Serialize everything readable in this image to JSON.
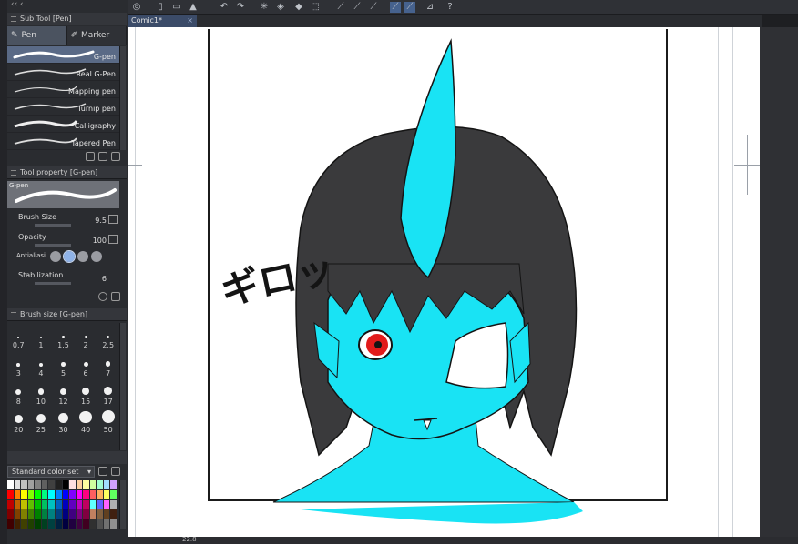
{
  "app": {
    "doc_tab": "Comic1*"
  },
  "subtool": {
    "header": "Sub Tool [Pen]",
    "tabs": [
      {
        "label": "Pen"
      },
      {
        "label": "Marker"
      }
    ],
    "brushes": [
      {
        "label": "G-pen"
      },
      {
        "label": "Real G-Pen"
      },
      {
        "label": "Mapping pen"
      },
      {
        "label": "Turnip pen"
      },
      {
        "label": "Calligraphy"
      },
      {
        "label": "Tapered Pen"
      }
    ]
  },
  "tool_property": {
    "header": "Tool property [G-pen]",
    "preview_label": "G-pen",
    "brush_size_label": "Brush Size",
    "brush_size_value": "9.5",
    "opacity_label": "Opacity",
    "opacity_value": "100",
    "antialias_label": "Antialiasi",
    "stabilization_label": "Stabilization",
    "stabilization_value": "6"
  },
  "brush_size_panel": {
    "header": "Brush size [G-pen]",
    "sizes": [
      "0.7",
      "1",
      "1.5",
      "2",
      "2.5",
      "3",
      "4",
      "5",
      "6",
      "7",
      "8",
      "10",
      "12",
      "15",
      "17",
      "20",
      "25",
      "30",
      "40",
      "50"
    ]
  },
  "color_set": {
    "label": "Standard color set",
    "colors": [
      "#ffffff",
      "#e0e0e0",
      "#c0c0c0",
      "#a0a0a0",
      "#808080",
      "#606060",
      "#404040",
      "#202020",
      "#000000",
      "#ffe0e0",
      "#ffd0a0",
      "#ffffa0",
      "#d0ffa0",
      "#a0ffd0",
      "#a0e0ff",
      "#d0a0ff",
      "#ff0000",
      "#ff8000",
      "#ffff00",
      "#80ff00",
      "#00ff00",
      "#00ff80",
      "#00ffff",
      "#0080ff",
      "#0000ff",
      "#8000ff",
      "#ff00ff",
      "#ff0080",
      "#ff6060",
      "#ffb060",
      "#ffff60",
      "#60ff60",
      "#c00000",
      "#c06000",
      "#c0c000",
      "#60c000",
      "#00c000",
      "#00c060",
      "#00c0c0",
      "#0060c0",
      "#0000c0",
      "#6000c0",
      "#c000c0",
      "#c00060",
      "#60ffff",
      "#6060ff",
      "#ff60ff",
      "#b0b0b0",
      "#800000",
      "#804000",
      "#808000",
      "#408000",
      "#008000",
      "#008040",
      "#008080",
      "#004080",
      "#000080",
      "#400080",
      "#800080",
      "#800040",
      "#c08060",
      "#806040",
      "#604020",
      "#402010",
      "#400000",
      "#402000",
      "#404000",
      "#204000",
      "#004000",
      "#004020",
      "#004040",
      "#002040",
      "#000040",
      "#200040",
      "#400040",
      "#400020",
      "#303030",
      "#505050",
      "#707070",
      "#909090"
    ]
  },
  "artwork": {
    "sfx_text": "ギロッ",
    "colors": {
      "skin": "#19e3f4",
      "hair": "#3a3a3c",
      "eye": "#e21b1b",
      "line": "#141414"
    }
  },
  "status": {
    "zoom": "22.8"
  }
}
